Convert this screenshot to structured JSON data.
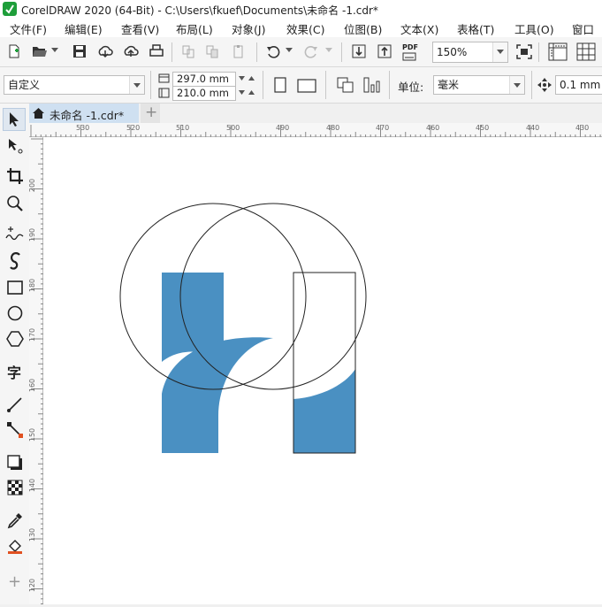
{
  "app": {
    "title": "CorelDRAW 2020 (64-Bit) - C:\\Users\\fkuef\\Documents\\未命名 -1.cdr*"
  },
  "menu": [
    {
      "id": "file",
      "label": "文件(F)"
    },
    {
      "id": "edit",
      "label": "编辑(E)"
    },
    {
      "id": "view",
      "label": "查看(V)"
    },
    {
      "id": "layout",
      "label": "布局(L)"
    },
    {
      "id": "object",
      "label": "对象(J)"
    },
    {
      "id": "effects",
      "label": "效果(C)"
    },
    {
      "id": "bitmaps",
      "label": "位图(B)"
    },
    {
      "id": "text",
      "label": "文本(X)"
    },
    {
      "id": "table",
      "label": "表格(T)"
    },
    {
      "id": "tools",
      "label": "工具(O)"
    },
    {
      "id": "window",
      "label": "窗口"
    }
  ],
  "toolbar": {
    "zoom_value": "150%",
    "pdf_label": "PDF"
  },
  "propbar": {
    "paper_preset": "自定义",
    "width_value": "297.0 mm",
    "height_value": "210.0 mm",
    "units_label": "单位:",
    "units_value": "毫米",
    "nudge_value": "0.1 mm"
  },
  "tools": {
    "text_tool_glyph": "字",
    "add_glyph": "+"
  },
  "tabs": {
    "document_label": "未命名 -1.cdr*",
    "add_tab_glyph": "+"
  },
  "rulers": {
    "horizontal": [
      "530",
      "520",
      "510",
      "500",
      "490",
      "480",
      "470",
      "460",
      "450",
      "440",
      "430"
    ],
    "vertical": [
      "200",
      "190",
      "180",
      "170",
      "160",
      "150",
      "140",
      "130",
      "120"
    ]
  },
  "colors": {
    "fill_blue": "#4a90c2",
    "outline": "#222222",
    "tab_active": "#cfe0f1",
    "logo_green": "#1e9e3a"
  }
}
